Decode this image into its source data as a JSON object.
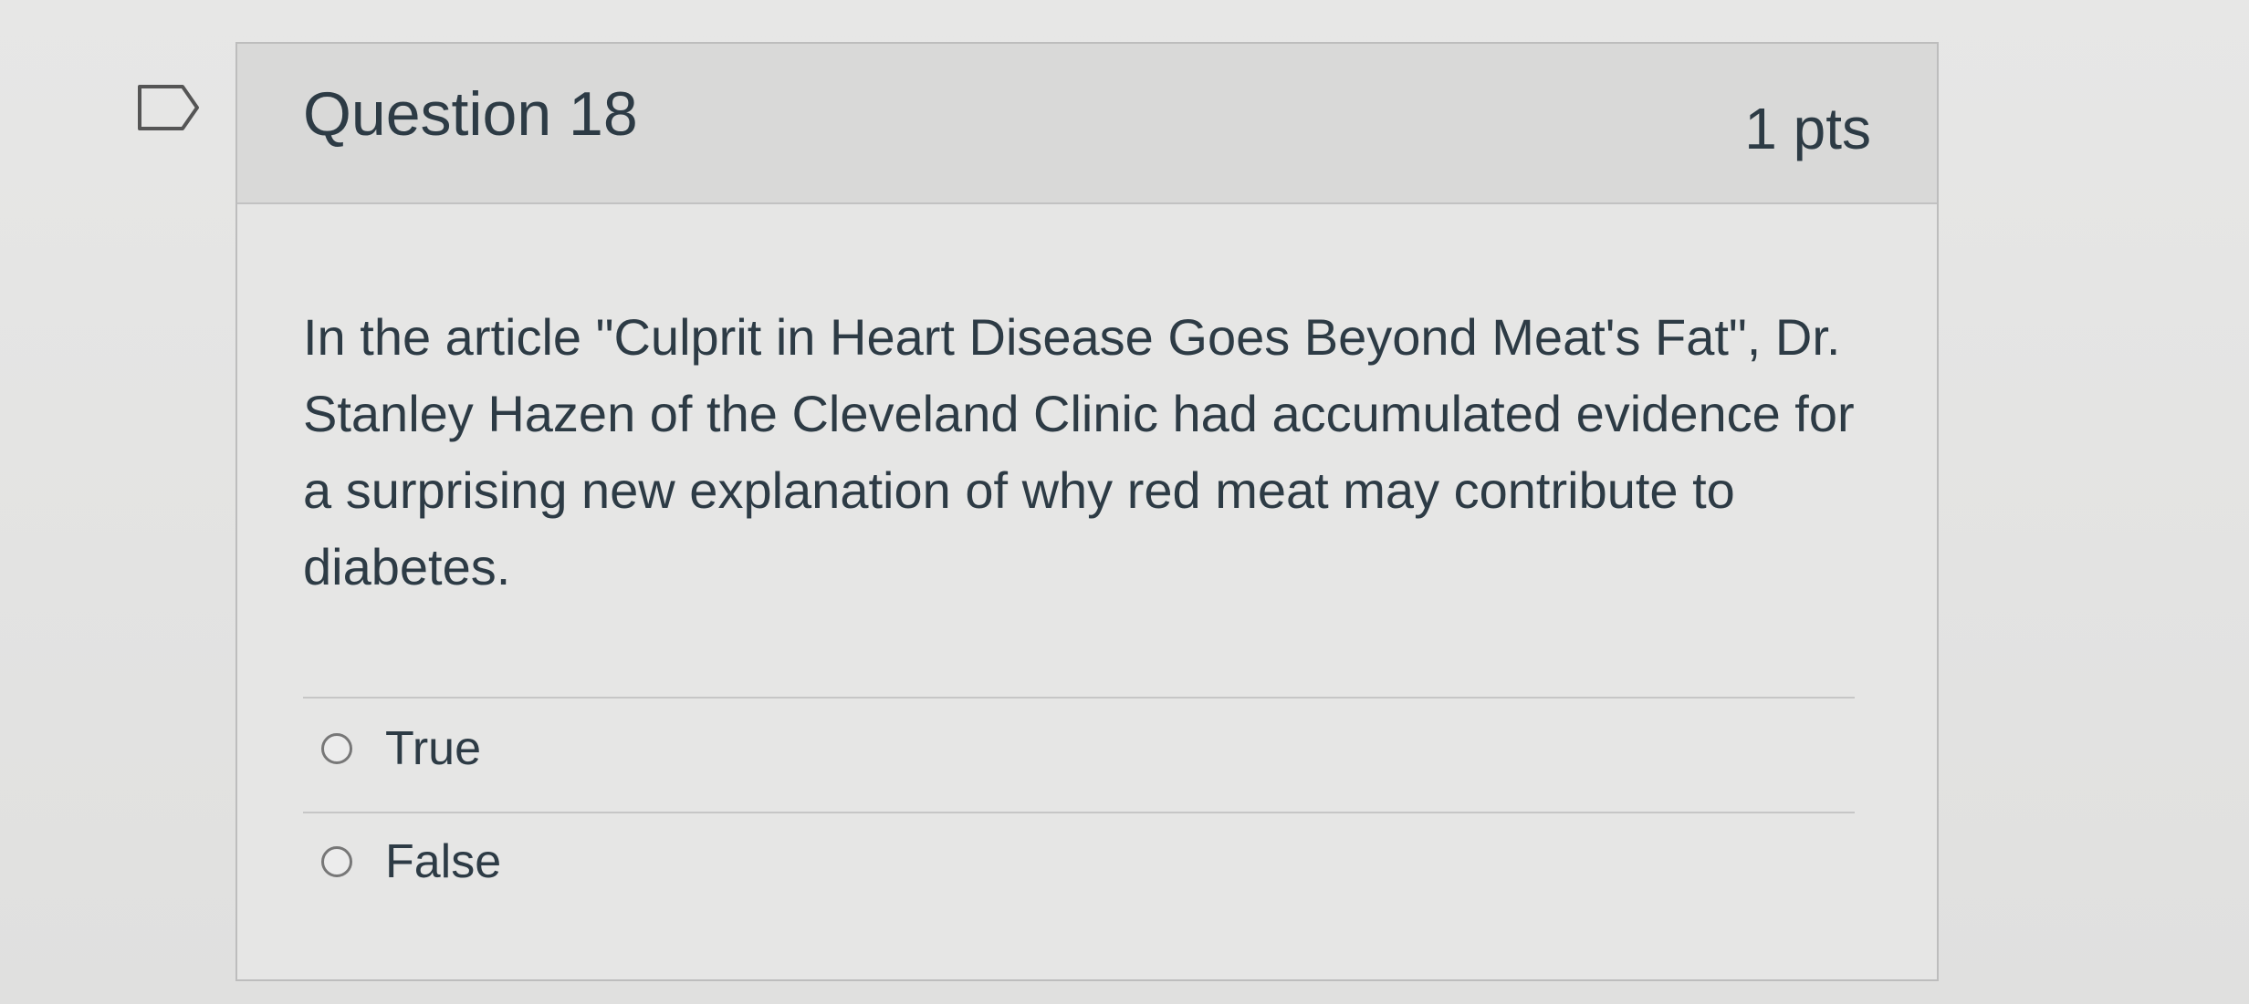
{
  "question": {
    "title": "Question 18",
    "points": "1 pts",
    "text": "In the article \"Culprit in Heart Disease Goes Beyond Meat's Fat\", Dr. Stanley Hazen of the Cleveland Clinic had accumulated evidence for a surprising new explanation of why red meat may contribute to diabetes.",
    "flag_icon": "flag-bookmark-icon",
    "answers": [
      {
        "label": "True",
        "selected": false
      },
      {
        "label": "False",
        "selected": false
      }
    ]
  },
  "colors": {
    "text": "#2d3b45",
    "header_bg": "#d9d9d8",
    "border": "#bdbdbd"
  }
}
